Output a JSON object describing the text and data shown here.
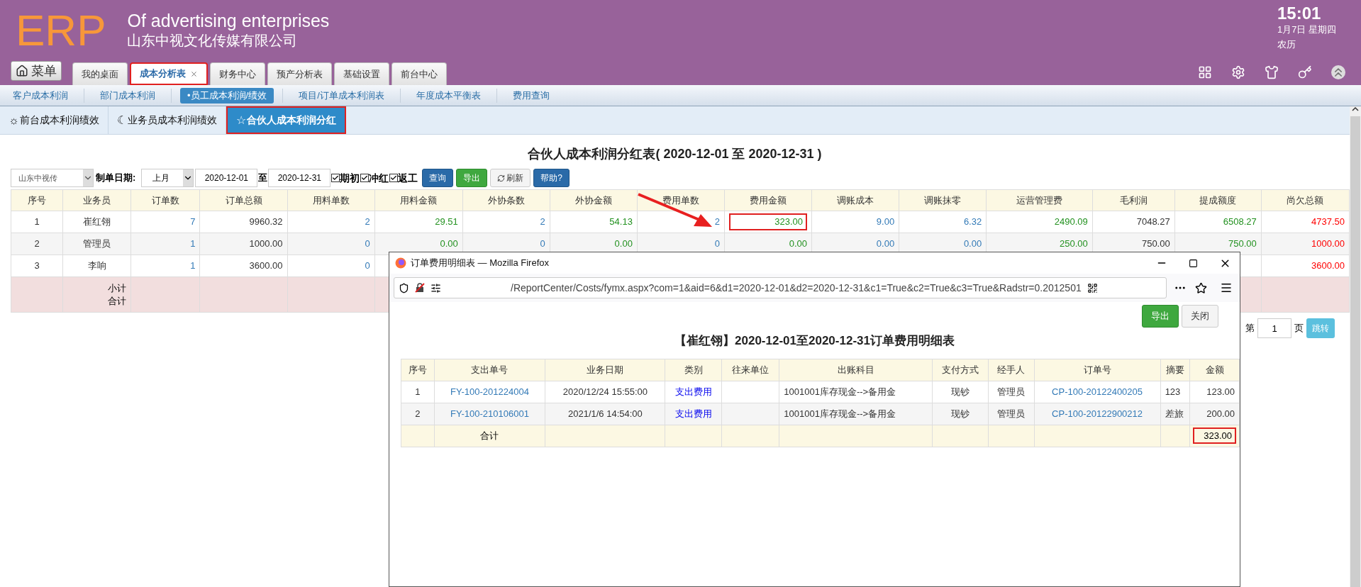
{
  "header": {
    "logo": "ERP",
    "slogan": "Of advertising enterprises",
    "company": "山东中视文化传媒有限公司",
    "clock": {
      "time": "15:01",
      "date": "1月7日 星期四",
      "lunar": "农历"
    }
  },
  "menu_button": "菜单",
  "tabs": [
    {
      "label": "我的桌面",
      "selected": false,
      "closable": false,
      "highlighted": false
    },
    {
      "label": "成本分析表",
      "selected": true,
      "closable": true,
      "highlighted": true
    },
    {
      "label": "财务中心",
      "selected": false,
      "closable": false,
      "highlighted": false
    },
    {
      "label": "预产分析表",
      "selected": false,
      "closable": false,
      "highlighted": false
    },
    {
      "label": "基础设置",
      "selected": false,
      "closable": false,
      "highlighted": false
    },
    {
      "label": "前台中心",
      "selected": false,
      "closable": false,
      "highlighted": false
    }
  ],
  "nav": [
    {
      "label": "客户成本利润",
      "selected": false
    },
    {
      "label": "部门成本利润",
      "selected": false
    },
    {
      "label": "•员工成本利润/绩效",
      "selected": true
    },
    {
      "label": "项目/订单成本利润表",
      "selected": false
    },
    {
      "label": "年度成本平衡表",
      "selected": false
    },
    {
      "label": "费用查询",
      "selected": false
    }
  ],
  "subtabs": [
    {
      "icon": "☼",
      "label": "前台成本利润绩效",
      "selected": false,
      "highlighted": false
    },
    {
      "icon": "☾",
      "label": "业务员成本利润绩效",
      "selected": false,
      "highlighted": false
    },
    {
      "icon": "☆",
      "label": "合伙人成本利润分红",
      "selected": true,
      "highlighted": true
    }
  ],
  "report": {
    "title": "合伙人成本利润分红表( 2020-12-01 至 2020-12-31 )",
    "filters": {
      "company": "山东中视传",
      "date_label": "制单日期:",
      "period": "上月",
      "from": "2020-12-01",
      "to_label": "至",
      "to": "2020-12-31",
      "checks": [
        {
          "label": "期初",
          "checked": true
        },
        {
          "label": "冲红",
          "checked": true
        },
        {
          "label": "返工",
          "checked": true
        }
      ],
      "buttons": [
        {
          "label": "查询",
          "kind": "primary"
        },
        {
          "label": "导出",
          "kind": "success"
        },
        {
          "label": "刷新",
          "kind": "refresh"
        },
        {
          "label": "帮助?",
          "kind": "primary"
        }
      ]
    },
    "table": {
      "columns": [
        {
          "label": "序号",
          "kind": "plain"
        },
        {
          "label": "业务员",
          "kind": "plain"
        },
        {
          "label": "订单数",
          "kind": "count"
        },
        {
          "label": "订单总额",
          "kind": "amount"
        },
        {
          "label": "用料单数",
          "kind": "count"
        },
        {
          "label": "用料金额",
          "kind": "money"
        },
        {
          "label": "外协条数",
          "kind": "count"
        },
        {
          "label": "外协金额",
          "kind": "money"
        },
        {
          "label": "费用单数",
          "kind": "count"
        },
        {
          "label": "费用金额",
          "kind": "money"
        },
        {
          "label": "调账成本",
          "kind": "count"
        },
        {
          "label": "调账抹零",
          "kind": "count"
        },
        {
          "label": "运营管理费",
          "kind": "money"
        },
        {
          "label": "毛利润",
          "kind": "amount"
        },
        {
          "label": "提成额度",
          "kind": "money"
        },
        {
          "label": "尚欠总额",
          "kind": "debt"
        }
      ],
      "rows": [
        {
          "cells": [
            "1",
            "崔红翎",
            "7",
            "9960.32",
            "2",
            "29.51",
            "2",
            "54.13",
            "2",
            {
              "text": "323.00",
              "boxed": true
            },
            "9.00",
            "6.32",
            "2490.09",
            "7048.27",
            "6508.27",
            "4737.50"
          ]
        },
        {
          "cells": [
            "2",
            "管理员",
            "1",
            "1000.00",
            "0",
            "0.00",
            "0",
            "0.00",
            "0",
            "0.00",
            "0.00",
            "0.00",
            "250.00",
            "750.00",
            "750.00",
            "1000.00"
          ]
        },
        {
          "cells": [
            "3",
            "李响",
            "1",
            "3600.00",
            "0",
            null,
            null,
            null,
            null,
            null,
            null,
            null,
            null,
            null,
            null,
            "3600.00"
          ]
        }
      ],
      "subtotal": [
        "小计",
        "合计"
      ]
    },
    "pager": {
      "prefix": "第",
      "page": "1",
      "suffix": "页",
      "button": "跳转"
    }
  },
  "popup": {
    "title": "订单费用明细表 — Mozilla Firefox",
    "url": "/ReportCenter/Costs/fymx.aspx?com=1&aid=6&d1=2020-12-01&d2=2020-12-31&c1=True&c2=True&c3=True&Radstr=0.2012501",
    "buttons": [
      {
        "label": "导出",
        "kind": "success"
      },
      {
        "label": "关闭",
        "kind": "default"
      }
    ],
    "heading": "【崔红翎】2020-12-01至2020-12-31订单费用明细表",
    "columns": [
      {
        "label": "序号",
        "kind": "center"
      },
      {
        "label": "支出单号",
        "kind": "link"
      },
      {
        "label": "业务日期",
        "kind": "center"
      },
      {
        "label": "类别",
        "kind": "tag"
      },
      {
        "label": "往来单位",
        "kind": "center"
      },
      {
        "label": "出账科目",
        "kind": "left"
      },
      {
        "label": "支付方式",
        "kind": "center"
      },
      {
        "label": "经手人",
        "kind": "center"
      },
      {
        "label": "订单号",
        "kind": "link"
      },
      {
        "label": "摘要",
        "kind": "left"
      },
      {
        "label": "金额",
        "kind": "right"
      }
    ],
    "rows": [
      [
        "1",
        "FY-100-201224004",
        "2020/12/24 15:55:00",
        "支出费用",
        null,
        "1001001库存现金-->备用金",
        "现钞",
        "管理员",
        "CP-100-20122400205",
        "123",
        "123.00"
      ],
      [
        "2",
        "FY-100-210106001",
        "2021/1/6 14:54:00",
        "支出费用",
        null,
        "1001001库存现金-->备用金",
        "现钞",
        "管理员",
        "CP-100-20122900212",
        "差旅",
        "200.00"
      ]
    ],
    "total": {
      "label": "合计",
      "amount": "323.00",
      "boxed": true
    }
  }
}
